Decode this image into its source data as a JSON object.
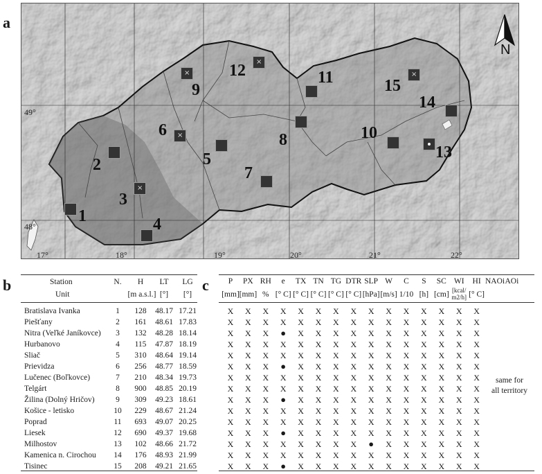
{
  "panels": {
    "a": "a",
    "b": "b",
    "c": "c"
  },
  "map": {
    "longitude_labels": [
      "17°",
      "18°",
      "19°",
      "20°",
      "21°",
      "22°"
    ],
    "latitude_labels": [
      "49°",
      "48°"
    ],
    "north_label": "N",
    "stations": [
      {
        "num": "1",
        "marker": "plain"
      },
      {
        "num": "2",
        "marker": "plain"
      },
      {
        "num": "3",
        "marker": "x"
      },
      {
        "num": "4",
        "marker": "plain"
      },
      {
        "num": "5",
        "marker": "plain"
      },
      {
        "num": "6",
        "marker": "x"
      },
      {
        "num": "7",
        "marker": "plain"
      },
      {
        "num": "8",
        "marker": "plain"
      },
      {
        "num": "9",
        "marker": "x"
      },
      {
        "num": "10",
        "marker": "plain"
      },
      {
        "num": "11",
        "marker": "plain"
      },
      {
        "num": "12",
        "marker": "x"
      },
      {
        "num": "13",
        "marker": "dot"
      },
      {
        "num": "14",
        "marker": "plain"
      },
      {
        "num": "15",
        "marker": "x"
      }
    ]
  },
  "station_table": {
    "headers": [
      "Station",
      "N.",
      "H",
      "LT",
      "LG"
    ],
    "units": [
      "Unit",
      "",
      "[m a.s.l.]",
      "[°]",
      "[°]"
    ],
    "rows": [
      [
        "Bratislava Ivanka",
        "1",
        "128",
        "48.17",
        "17.21"
      ],
      [
        "Piešťany",
        "2",
        "161",
        "48.61",
        "17.83"
      ],
      [
        "Nitra (Veľké Janíkovce)",
        "3",
        "132",
        "48.28",
        "18.14"
      ],
      [
        "Hurbanovo",
        "4",
        "115",
        "47.87",
        "18.19"
      ],
      [
        "Sliač",
        "5",
        "310",
        "48.64",
        "19.14"
      ],
      [
        "Prievidza",
        "6",
        "256",
        "48.77",
        "18.59"
      ],
      [
        "Lučenec (Boľkovce)",
        "7",
        "210",
        "48.34",
        "19.73"
      ],
      [
        "Telgárt",
        "8",
        "900",
        "48.85",
        "20.19"
      ],
      [
        "Žilina (Dolný Hričov)",
        "9",
        "309",
        "49.23",
        "18.61"
      ],
      [
        "Košice - letisko",
        "10",
        "229",
        "48.67",
        "21.24"
      ],
      [
        "Poprad",
        "11",
        "693",
        "49.07",
        "20.25"
      ],
      [
        "Liesek",
        "12",
        "690",
        "49.37",
        "19.68"
      ],
      [
        "Milhostov",
        "13",
        "102",
        "48.66",
        "21.72"
      ],
      [
        "Kamenica n. Cirochou",
        "14",
        "176",
        "48.93",
        "21.99"
      ],
      [
        "Tisinec",
        "15",
        "208",
        "49.21",
        "21.65"
      ]
    ]
  },
  "variable_table": {
    "headers": [
      "P",
      "PX",
      "RH",
      "e",
      "TX",
      "TN",
      "TG",
      "DTR",
      "SLP",
      "W",
      "C",
      "S",
      "SC",
      "WI",
      "HI",
      "NAOi",
      "AOi"
    ],
    "units": [
      "[mm]",
      "[mm]",
      "%",
      "[° C]",
      "[° C]",
      "[° C]",
      "[° C]",
      "[° C]",
      "[hPa]",
      "[m/s]",
      "1/10",
      "[h]",
      "[cm]",
      "[kcal/ m2/h]",
      "[° C]",
      "",
      ""
    ],
    "x_symbol": "X",
    "dot_symbol": "●",
    "rows": [
      "XXXXXXXXXXXXXXX",
      "XXXXXXXXXXXXXXX",
      "XXX●XXXXXXXXXXX",
      "XXXXXXXXXXXXXXX",
      "XXXXXXXXXXXXXXX",
      "XXX●XXXXXXXXXXX",
      "XXXXXXXXXXXXXXX",
      "XXXXXXXXXXXXXXX",
      "XXX●XXXXXXXXXXX",
      "XXXXXXXXXXXXXXX",
      "XXXXXXXXXXXXXXX",
      "XXX●XXXXXXXXXXX",
      "XXXXXXXX●XXXXXX",
      "XXXXXXXXXXXXXXX",
      "XXX●XXXXXXXXXXX"
    ],
    "note_line1": "same for",
    "note_line2": "all territory"
  }
}
